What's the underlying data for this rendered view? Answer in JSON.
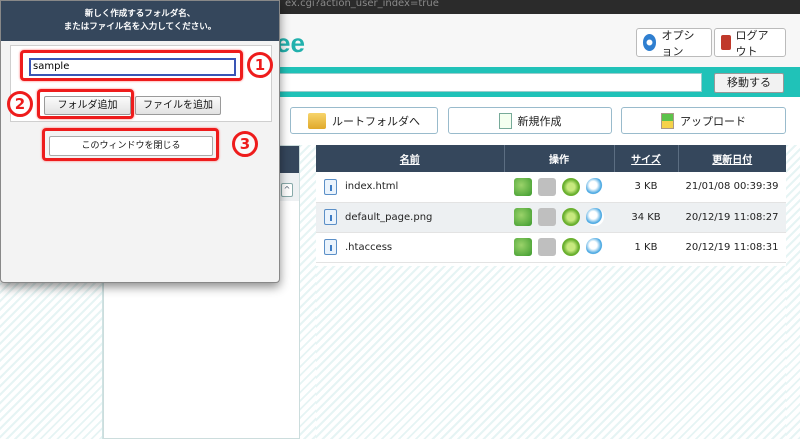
{
  "browser": {
    "url_fragment": "ex.cgi?action_user_index=true"
  },
  "header": {
    "logo_text": "ee",
    "options_label": "オプション",
    "logout_label": "ログアウト"
  },
  "pathbar": {
    "move_label": "移動する"
  },
  "actions": {
    "root_folder": "ルートフォルダへ",
    "new_create": "新規作成",
    "upload": "アップロード"
  },
  "tree": {
    "toggle_glyph": "^"
  },
  "table": {
    "headers": {
      "name": "名前",
      "ops": "操作",
      "size": "サイズ",
      "updated": "更新日付"
    },
    "rows": [
      {
        "name": "index.html",
        "size": "3 KB",
        "updated": "21/01/08 00:39:39"
      },
      {
        "name": "default_page.png",
        "size": "34 KB",
        "updated": "20/12/19 11:08:27"
      },
      {
        "name": ".htaccess",
        "size": "1 KB",
        "updated": "20/12/19 11:08:31"
      }
    ]
  },
  "dialog": {
    "title_line1": "新しく作成するフォルダ名、",
    "title_line2": "またはファイル名を入力してください。",
    "input_value": "sample",
    "add_folder": "フォルダ追加",
    "add_file": "ファイルを追加",
    "close_window": "このウィンドウを閉じる"
  },
  "annotations": {
    "step1": "1",
    "step2": "2",
    "step3": "3",
    "color": "#ee1c1c"
  }
}
